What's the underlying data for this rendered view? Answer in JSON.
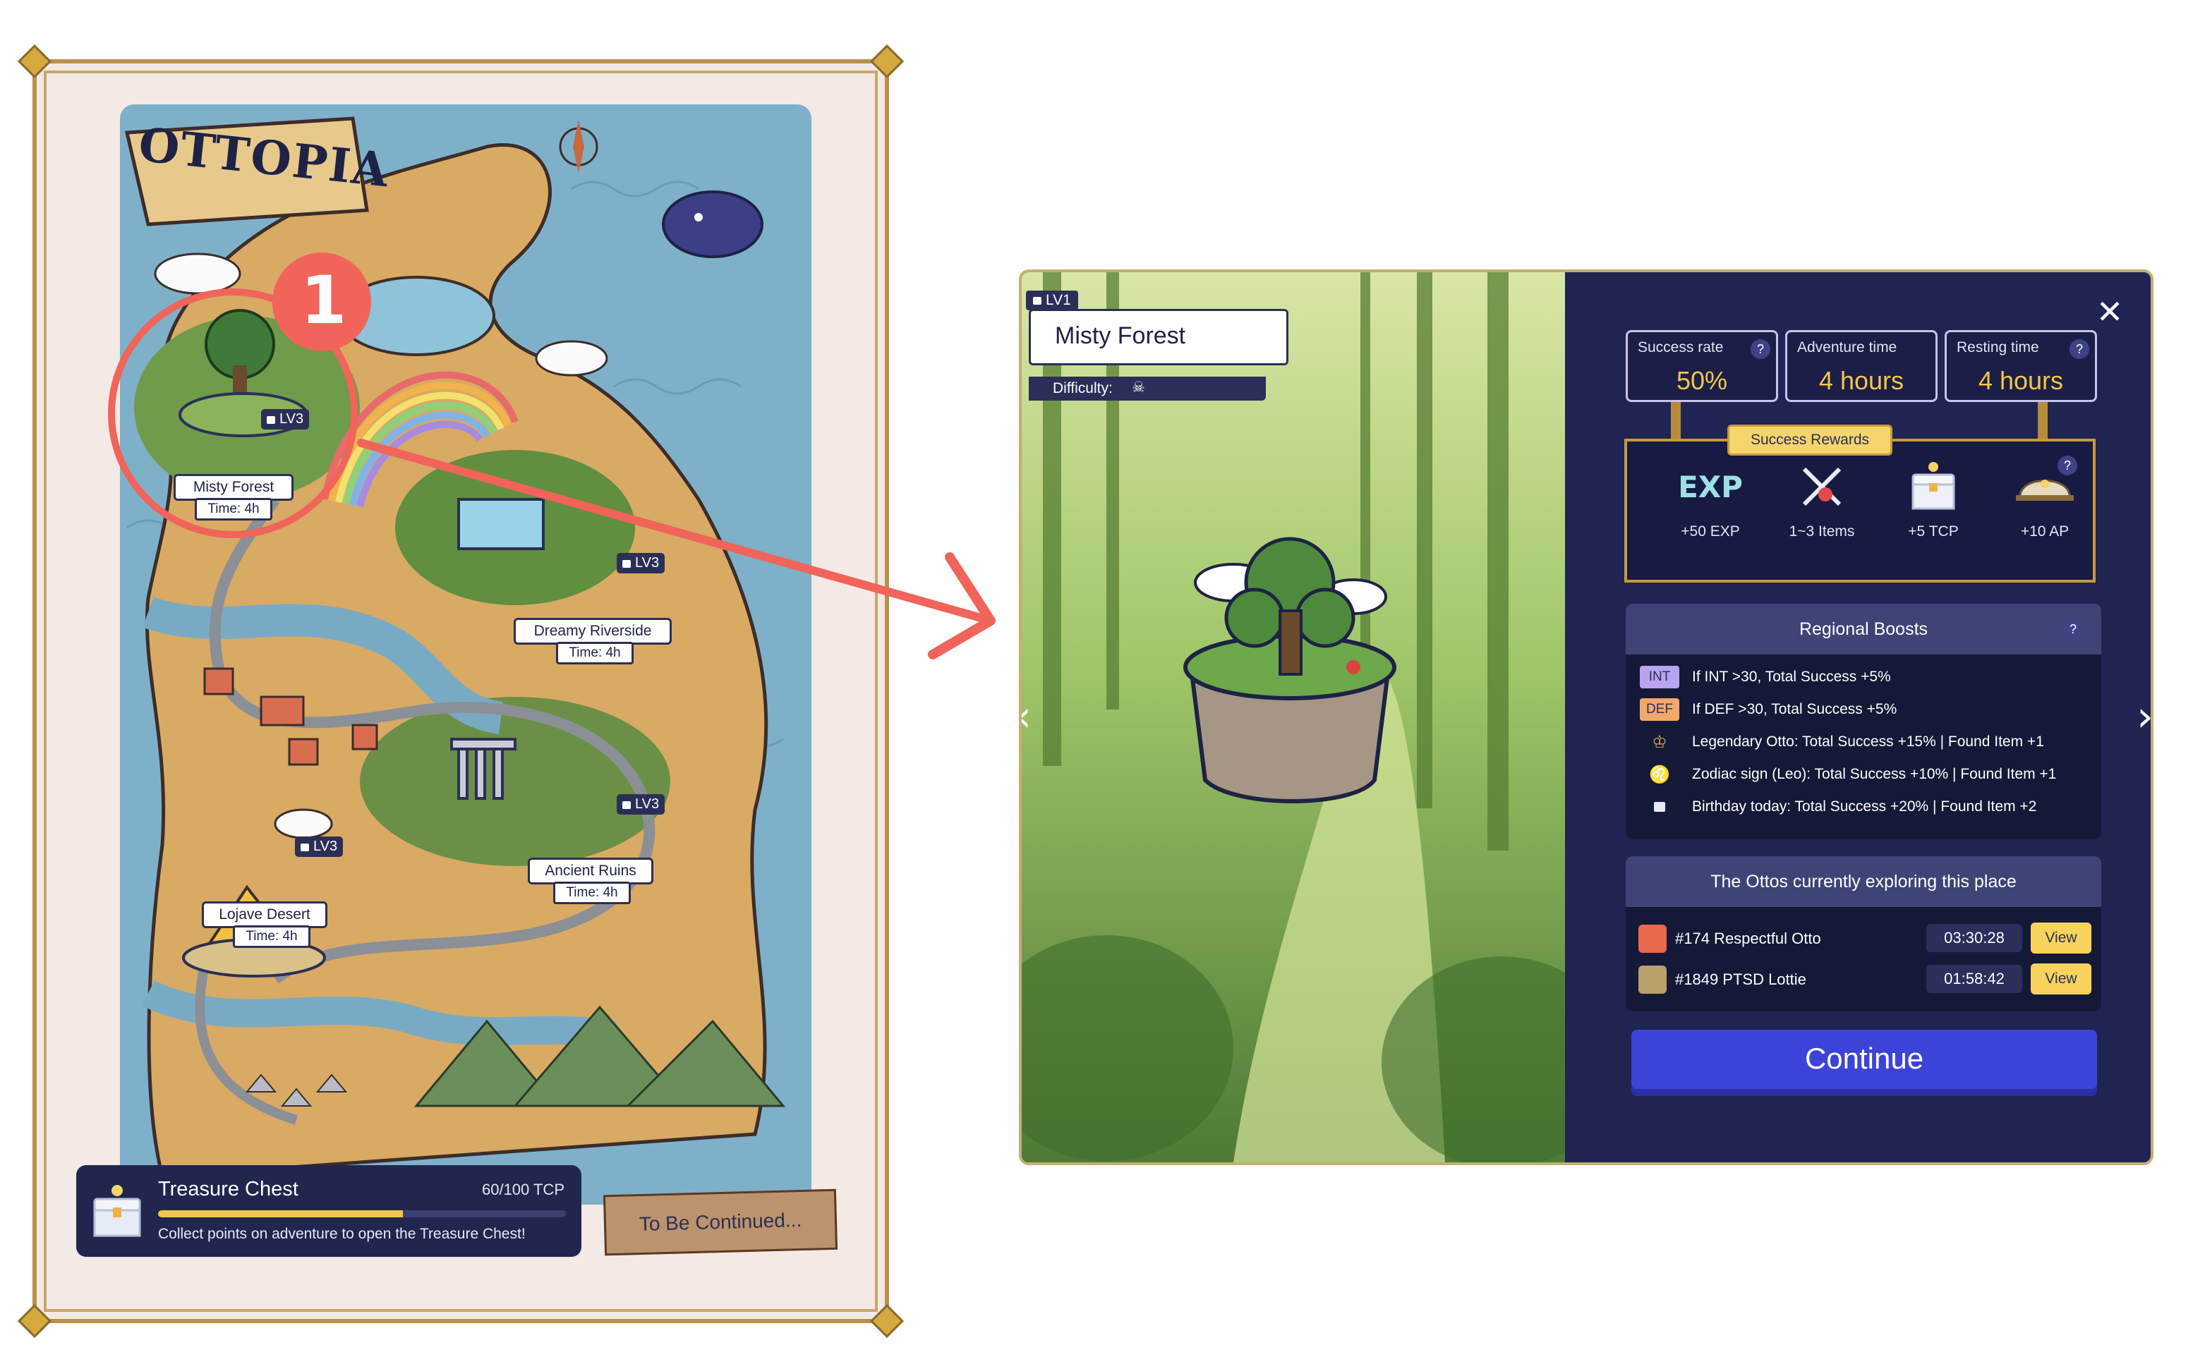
{
  "map": {
    "title": "OTTOPIA",
    "locations": [
      {
        "name": "Misty Forest",
        "time": "Time: 4h",
        "level": "LV3"
      },
      {
        "name": "Dreamy Riverside",
        "time": "Time: 4h",
        "level": "LV3"
      },
      {
        "name": "Ancient Ruins",
        "time": "Time: 4h",
        "level": "LV3"
      },
      {
        "name": "Lojave Desert",
        "time": "Time: 4h",
        "level": "LV3"
      }
    ],
    "annotation_number": "1",
    "treasure": {
      "title": "Treasure Chest",
      "count": "60/100 TCP",
      "progress_fraction": 0.6,
      "description": "Collect points on adventure to open the Treasure Chest!"
    },
    "to_be_continued": "To Be Continued..."
  },
  "detail": {
    "level": "LV1",
    "title": "Misty Forest",
    "difficulty_label": "Difficulty:",
    "stats": [
      {
        "label": "Success rate",
        "value": "50%",
        "help": "?"
      },
      {
        "label": "Adventure time",
        "value": "4 hours"
      },
      {
        "label": "Resting time",
        "value": "4 hours",
        "help": "?"
      }
    ],
    "rewards": {
      "tag": "Success Rewards",
      "help": "?",
      "items": [
        {
          "icon": "exp-icon",
          "icon_text": "EXP",
          "label": "+50 EXP"
        },
        {
          "icon": "sword-icon",
          "label": "1~3 Items"
        },
        {
          "icon": "chest-icon",
          "label": "+5 TCP"
        },
        {
          "icon": "helmet-icon",
          "label": "+10 AP"
        }
      ]
    },
    "boosts": {
      "title": "Regional Boosts",
      "help": "?",
      "rows": [
        {
          "tag": "INT",
          "text": "If INT >30, Total Success +5%"
        },
        {
          "tag": "DEF",
          "text": "If DEF >30, Total Success +5%"
        },
        {
          "icon": "legendary-icon",
          "text": "Legendary Otto: Total Success +15% | Found Item +1"
        },
        {
          "icon": "zodiac-leo-icon",
          "text": "Zodiac sign (Leo): Total Success +10% | Found Item +1"
        },
        {
          "icon": "birthday-cake-icon",
          "text": "Birthday today: Total Success +20% | Found Item +2"
        }
      ]
    },
    "ottos": {
      "title": "The Ottos currently exploring this place",
      "rows": [
        {
          "name": "#174 Respectful Otto",
          "time": "03:30:28",
          "view": "View"
        },
        {
          "name": "#1849 PTSD Lottie",
          "time": "01:58:42",
          "view": "View"
        }
      ]
    },
    "continue": "Continue"
  },
  "colors": {
    "panel_bg": "#1f2452",
    "accent_yellow": "#f3c64a",
    "continue_blue": "#3c44d7",
    "annotation_red": "#f0645a"
  }
}
